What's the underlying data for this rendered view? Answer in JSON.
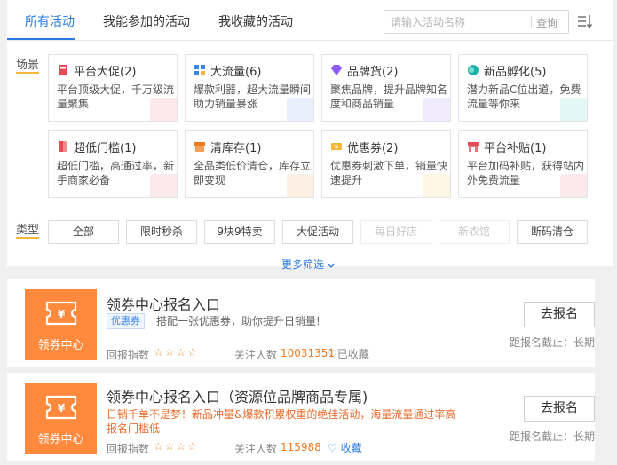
{
  "tabs": [
    {
      "label": "所有活动",
      "active": true
    },
    {
      "label": "我能参加的活动",
      "active": false
    },
    {
      "label": "我收藏的活动",
      "active": false
    }
  ],
  "search": {
    "placeholder": "请输入活动名称",
    "button": "查询"
  },
  "scene_label": "场景",
  "scenes": [
    {
      "title": "平台大促(2)",
      "desc": "平台顶级大促，千万级流量聚集",
      "icon": "flag-icon",
      "color": "#e84a57"
    },
    {
      "title": "大流量(6)",
      "desc": "爆款利器，超大流量瞬间助力销量暴涨",
      "icon": "grid-icon",
      "color": "#3a86e6"
    },
    {
      "title": "品牌货(2)",
      "desc": "聚焦品牌，提升品牌知名度和商品销量",
      "icon": "diamond-icon",
      "color": "#8b5cf6"
    },
    {
      "title": "新品孵化(5)",
      "desc": "潜力新品C位出道，免费流量等你来",
      "icon": "bubble-icon",
      "color": "#20b2aa"
    },
    {
      "title": "超低门槛(1)",
      "desc": "超低门槛，高通过率，新手商家必备",
      "icon": "door-icon",
      "color": "#e84a57"
    },
    {
      "title": "清库存(1)",
      "desc": "全品类低价清仓，库存立即变现",
      "icon": "box-icon",
      "color": "#f07a1f"
    },
    {
      "title": "优惠券(2)",
      "desc": "优惠券刺激下单，销量快速提升",
      "icon": "coupon-icon",
      "color": "#f4b73a"
    },
    {
      "title": "平台补贴(1)",
      "desc": "平台加码补贴，获得站内外免费流量",
      "icon": "shop-icon",
      "color": "#e84a57"
    }
  ],
  "type_label": "类型",
  "types": [
    {
      "label": "全部",
      "enabled": true
    },
    {
      "label": "限时秒杀",
      "enabled": true
    },
    {
      "label": "9块9特卖",
      "enabled": true
    },
    {
      "label": "大促活动",
      "enabled": true
    },
    {
      "label": "每日好店",
      "enabled": false
    },
    {
      "label": "新衣馆",
      "enabled": false
    },
    {
      "label": "断码清仓",
      "enabled": true
    }
  ],
  "more_filters": "更多筛选",
  "activities": [
    {
      "logo_text": "领券中心",
      "title": "领券中心报名入口",
      "tag": "优惠券",
      "desc": "搭配一张优惠券，助你提升日销量!",
      "index_label": "回报指数",
      "stars": "☆☆☆☆",
      "followers_label": "关注人数",
      "followers": "10031351",
      "fav_label": "已收藏",
      "button": "去报名",
      "deadline": "距报名截止：长期"
    },
    {
      "logo_text": "领券中心",
      "title": "领券中心报名入口（资源位品牌商品专属)",
      "desc": "日销千单不是梦！新品冲量&爆款积累权重的绝佳活动，海量流量通过率高报名门槛低",
      "index_label": "回报指数",
      "stars": "☆☆☆☆",
      "followers_label": "关注人数",
      "followers": "115988",
      "fav_label": "收藏",
      "button": "去报名",
      "deadline": "距报名截止：长期"
    }
  ]
}
